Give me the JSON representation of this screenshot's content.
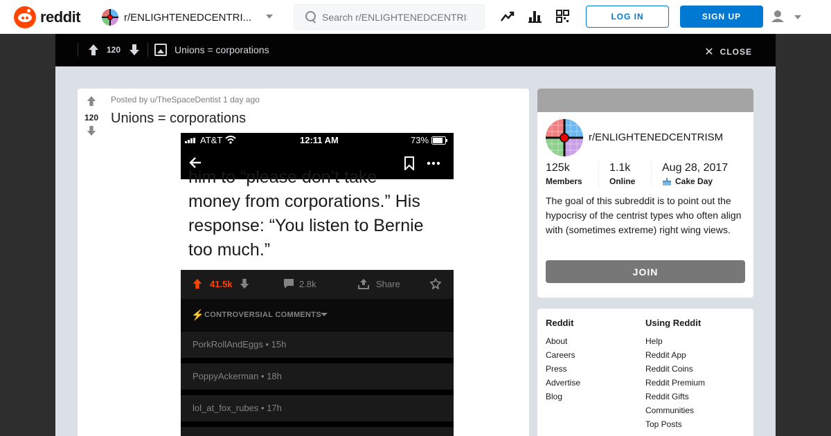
{
  "header": {
    "logo_text": "reddit",
    "subreddit_selector": "r/ENLIGHTENEDCENTRI...",
    "search_placeholder": "Search r/ENLIGHTENEDCENTRISM",
    "login_label": "LOG IN",
    "signup_label": "SIGN UP",
    "icons": [
      "trending-icon",
      "stats-icon",
      "coins-icon",
      "user-icon",
      "chevron-down-icon"
    ]
  },
  "post_bar": {
    "score": "120",
    "title": "Unions = corporations",
    "close_label": "CLOSE"
  },
  "post": {
    "score": "120",
    "meta": "Posted by u/TheSpaceDentist 1 day ago",
    "title": "Unions = corporations",
    "image": {
      "status_carrier": "AT&T",
      "status_time": "12:11 AM",
      "status_battery": "73%",
      "text_lines": [
        "him to “please don’t take",
        "money from corporations.”  His",
        "response: “You listen to Bernie",
        "too much.”"
      ],
      "upvotes": "41.5k",
      "comments": "2.8k",
      "share_label": "Share",
      "sort_label": "CONTROVERSIAL COMMENTS",
      "comment_rows": [
        "PorkRollAndEggs • 15h",
        "PoppyAckerman • 18h",
        "lol_at_fox_rubes • 17h"
      ]
    }
  },
  "sidebar": {
    "about": {
      "name": "r/ENLIGHTENEDCENTRISM",
      "members_value": "125k",
      "members_label": "Members",
      "online_value": "1.1k",
      "online_label": "Online",
      "cakeday_value": "Aug 28, 2017",
      "cakeday_label": "Cake Day",
      "description": "The goal of this subreddit is to point out the hypocrisy of the centrist types who often align with (sometimes extreme) right wing views.",
      "join_label": "JOIN"
    },
    "links": {
      "col1_title": "Reddit",
      "col1": [
        "About",
        "Careers",
        "Press",
        "Advertise",
        "Blog"
      ],
      "col2_title": "Using Reddit",
      "col2": [
        "Help",
        "Reddit App",
        "Reddit Coins",
        "Reddit Premium",
        "Reddit Gifts",
        "Communities",
        "Top Posts"
      ]
    }
  },
  "colors": {
    "brand": "#ff4500",
    "primary": "#0079d3",
    "backdrop": "#2e2e2e",
    "modal_bg": "#dae0e6"
  }
}
